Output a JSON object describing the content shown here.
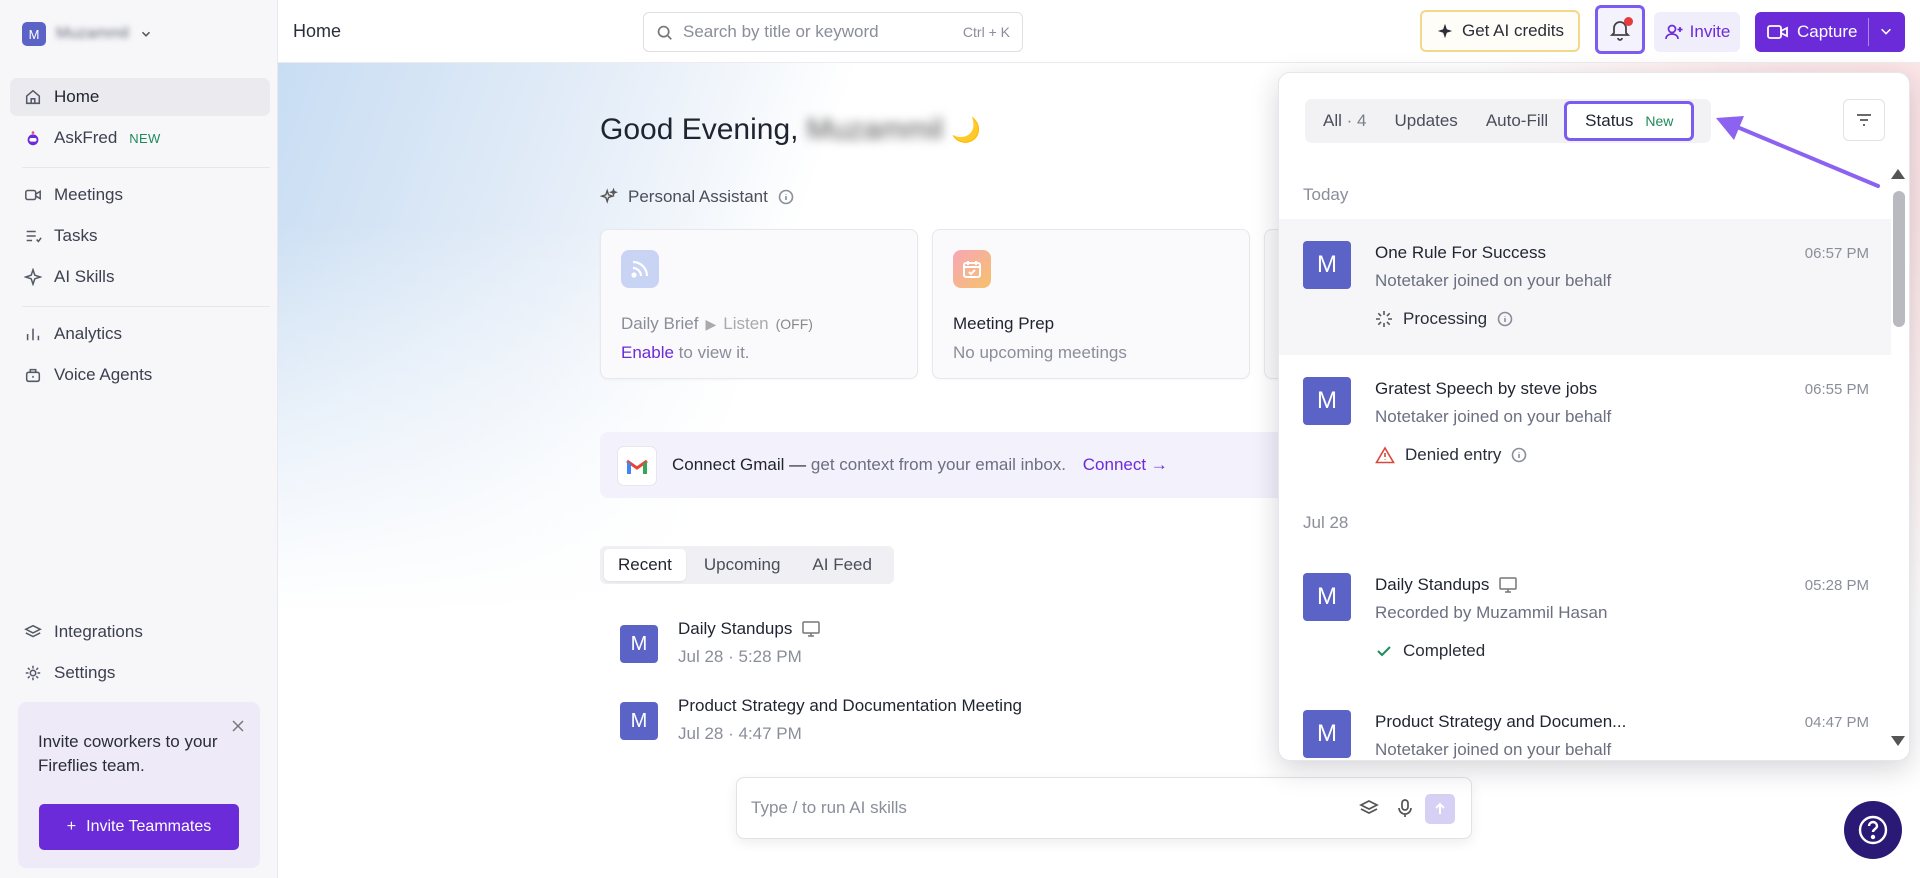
{
  "workspace": {
    "avatar_letter": "M",
    "name": "Muzammil"
  },
  "sidebar": {
    "items": [
      {
        "label": "Home"
      },
      {
        "label": "AskFred",
        "badge": "NEW"
      },
      {
        "label": "Meetings"
      },
      {
        "label": "Tasks"
      },
      {
        "label": "AI Skills"
      },
      {
        "label": "Analytics"
      },
      {
        "label": "Voice Agents"
      },
      {
        "label": "Integrations"
      },
      {
        "label": "Settings"
      }
    ],
    "invite_card": {
      "text": "Invite coworkers to your Fireflies team.",
      "button": "Invite Teammates"
    }
  },
  "topbar": {
    "breadcrumb": "Home",
    "search_placeholder": "Search by title or keyword",
    "search_shortcut": "Ctrl + K",
    "credits_label": "Get AI credits",
    "invite_label": "Invite",
    "capture_label": "Capture"
  },
  "main": {
    "greeting": "Good Evening,",
    "greeting_name": "Muzammil",
    "greeting_emoji": "🌙",
    "assistant_label": "Personal Assistant",
    "cards": [
      {
        "title": "Daily Brief",
        "listen": "Listen",
        "listen_state": "(OFF)",
        "link": "Enable",
        "subtitle_rest": "to view it."
      },
      {
        "title": "Meeting Prep",
        "subtitle": "No upcoming meetings"
      }
    ],
    "gmail": {
      "title": "Connect Gmail —",
      "desc": "get context from your email inbox.",
      "link": "Connect →"
    },
    "tabs": [
      "Recent",
      "Upcoming",
      "AI Feed"
    ],
    "meetings": [
      {
        "avatar": "M",
        "title": "Daily Standups",
        "date": "Jul 28",
        "time": "5:28 PM"
      },
      {
        "avatar": "M",
        "title": "Product Strategy and Documentation Meeting",
        "date": "Jul 28",
        "time": "4:47 PM"
      }
    ],
    "composer_placeholder": "Type / to run AI skills"
  },
  "notifications": {
    "tabs": [
      {
        "label": "All",
        "count": "· 4"
      },
      {
        "label": "Updates"
      },
      {
        "label": "Auto-Fill"
      },
      {
        "label": "Status",
        "badge": "New"
      }
    ],
    "sections": [
      {
        "label": "Today",
        "items": [
          {
            "avatar": "M",
            "title": "One Rule For Success",
            "time": "06:57 PM",
            "subtitle": "Notetaker joined on your behalf",
            "status": "Processing"
          },
          {
            "avatar": "M",
            "title": "Gratest Speech by steve jobs",
            "time": "06:55 PM",
            "subtitle": "Notetaker joined on your behalf",
            "status": "Denied entry"
          }
        ]
      },
      {
        "label": "Jul 28",
        "items": [
          {
            "avatar": "M",
            "title": "Daily Standups",
            "time": "05:28 PM",
            "subtitle": "Recorded by Muzammil Hasan",
            "status": "Completed"
          },
          {
            "avatar": "M",
            "title": "Product Strategy and Documen...",
            "time": "04:47 PM",
            "subtitle": "Notetaker joined on your behalf"
          }
        ]
      }
    ]
  },
  "colors": {
    "accent": "#6c2bd9",
    "highlight": "#7c5cf0",
    "avatar": "#5b63c7",
    "success": "#1f8a5b",
    "danger": "#e53b3b"
  }
}
